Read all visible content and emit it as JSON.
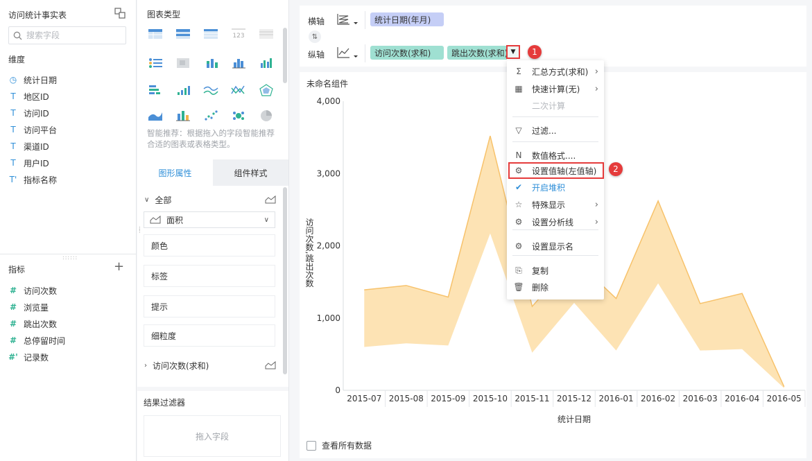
{
  "field_panel": {
    "title": "访问统计事实表",
    "search_placeholder": "搜索字段",
    "dimension_label": "维度",
    "dimensions": [
      {
        "icon": "clock-icon",
        "glyph": "◷",
        "label": "统计日期"
      },
      {
        "icon": "text-type-icon",
        "glyph": "T",
        "label": "地区ID"
      },
      {
        "icon": "text-type-icon",
        "glyph": "T",
        "label": "访问ID"
      },
      {
        "icon": "text-type-icon",
        "glyph": "T",
        "label": "访问平台"
      },
      {
        "icon": "text-type-icon",
        "glyph": "T",
        "label": "渠道ID"
      },
      {
        "icon": "text-type-icon",
        "glyph": "T",
        "label": "用户ID"
      },
      {
        "icon": "text-calc-type-icon",
        "glyph": "T'",
        "label": "指标名称"
      }
    ],
    "measure_label": "指标",
    "measures": [
      {
        "icon": "number-type-icon",
        "glyph": "#",
        "label": "访问次数"
      },
      {
        "icon": "number-type-icon",
        "glyph": "#",
        "label": "浏览量"
      },
      {
        "icon": "number-type-icon",
        "glyph": "#",
        "label": "跳出次数"
      },
      {
        "icon": "number-type-icon",
        "glyph": "#",
        "label": "总停留时间"
      },
      {
        "icon": "number-calc-type-icon",
        "glyph": "#'",
        "label": "记录数"
      }
    ]
  },
  "prop_panel": {
    "chart_type_title": "图表类型",
    "hint": "智能推荐：根据拖入的字段智能推荐合适的图表或表格类型。",
    "tabs": [
      "图形属性",
      "组件样式"
    ],
    "all_label": "全部",
    "selected_type": "面积",
    "props": [
      "颜色",
      "标签",
      "提示",
      "细粒度"
    ],
    "measure_row": "访问次数(求和)",
    "filter_title": "结果过滤器",
    "drop_hint": "拖入字段"
  },
  "axis": {
    "x_label": "横轴",
    "y_label": "纵轴",
    "x_pill": "统计日期(年月)",
    "y_pills": [
      "访问次数(求和)",
      "跳出次数(求和)"
    ],
    "swap_glyph": "⇅",
    "badge1": "1",
    "badge2": "2"
  },
  "component_title": "未命名组件",
  "view_all": "查看所有数据",
  "menu": {
    "items": [
      {
        "icon": "sigma-icon",
        "glyph": "Σ",
        "label": "汇总方式(求和)",
        "sub": true
      },
      {
        "icon": "quick-calc-icon",
        "glyph": "▦",
        "label": "快速计算(无)",
        "sub": true
      },
      {
        "icon": "",
        "glyph": "",
        "label": "二次计算",
        "disabled": true
      },
      {
        "icon": "filter-icon",
        "glyph": "▽",
        "label": "过滤..."
      },
      {
        "icon": "number-format-icon",
        "glyph": "N",
        "label": "数值格式...."
      },
      {
        "icon": "gear-icon",
        "glyph": "⚙",
        "label": "设置值轴(左值轴)"
      },
      {
        "icon": "check-icon",
        "glyph": "✔",
        "label": "开启堆积",
        "blue": true
      },
      {
        "icon": "star-icon",
        "glyph": "☆",
        "label": "特殊显示",
        "sub": true
      },
      {
        "icon": "gear-icon",
        "glyph": "⚙",
        "label": "设置分析线",
        "sub": true
      },
      {
        "icon": "gear-icon",
        "glyph": "⚙",
        "label": "设置显示名"
      },
      {
        "icon": "copy-icon",
        "glyph": "⎘",
        "label": "复制"
      },
      {
        "icon": "trash-icon",
        "glyph": "🗑",
        "label": "删除"
      }
    ],
    "arrow_glyph": "›"
  },
  "chart_data": {
    "type": "area",
    "stacked": true,
    "x": [
      "2015-07",
      "2015-08",
      "2015-09",
      "2015-10",
      "2015-11",
      "2015-12",
      "2016-01",
      "2016-02",
      "2016-03",
      "2016-04",
      "2016-05"
    ],
    "series": [
      {
        "values": [
          600,
          650,
          620,
          2170,
          520,
          1210,
          550,
          1480,
          550,
          570,
          30
        ]
      },
      {
        "values": [
          790,
          800,
          670,
          1350,
          640,
          610,
          720,
          1140,
          650,
          770,
          20
        ]
      }
    ],
    "ylim": [
      0,
      4000
    ],
    "yticks": [
      "0",
      "1,000",
      "2,000",
      "3,000",
      "4,000"
    ],
    "ylabel": "访问次数,跳出次数",
    "xlabel": "统计日期",
    "colors": {
      "fill": "#fde3b4",
      "line": "#f7c26b"
    }
  }
}
